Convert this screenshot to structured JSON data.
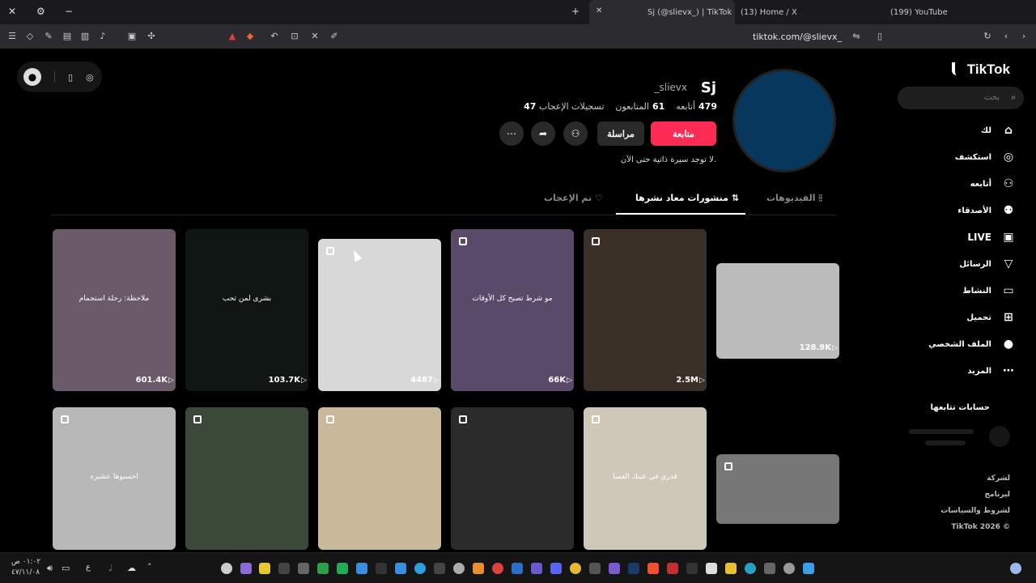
{
  "tabs": [
    {
      "label": "Sj (@slievx_) | TikTok",
      "active": true
    },
    {
      "label": "(13) Home / X",
      "active": false
    },
    {
      "label": "(199) YouTube",
      "active": false
    }
  ],
  "url": "tiktok.com/@slievx_",
  "sidebar": {
    "logo": "TikTok",
    "search_placeholder": "بحث",
    "items": [
      {
        "label": "لك",
        "icon": "home-icon"
      },
      {
        "label": "استكشف",
        "icon": "compass-icon"
      },
      {
        "label": "أتابعه",
        "icon": "user-follow-icon"
      },
      {
        "label": "الأصدقاء",
        "icon": "friends-icon"
      },
      {
        "label": "LIVE",
        "icon": "live-icon"
      },
      {
        "label": "الرسائل",
        "icon": "send-icon"
      },
      {
        "label": "النشاط",
        "icon": "activity-icon"
      },
      {
        "label": "تحميل",
        "icon": "upload-icon"
      },
      {
        "label": "الملف الشخصي",
        "icon": "profile-icon"
      },
      {
        "label": "المزيد",
        "icon": "more-icon"
      }
    ],
    "following_title": "حسابات تتابعها",
    "footer": [
      "لشركة",
      "ليرنامج",
      "لشروط والسياسات",
      "TikTok 2026 ©"
    ]
  },
  "profile": {
    "name": "Sj",
    "handle": "_slievx",
    "following_label": "أتابعه",
    "following_count": "479",
    "followers_label": "المتابعون",
    "followers_count": "61",
    "likes_label": "تسجيلات الإعجاب",
    "likes_count": "47",
    "follow_button": "متابعة",
    "message_button": "مراسلة",
    "bio": "لا توجد سيرة ذاتية حتى الآن."
  },
  "profile_tabs": [
    {
      "label": "الفيديوهات",
      "active": false
    },
    {
      "label": "منشورات معاد نشرها",
      "active": true
    },
    {
      "label": "تم الإعجاب",
      "active": false
    }
  ],
  "videos": [
    {
      "views": "128.9K",
      "bg": "#bbbbbb",
      "text": ""
    },
    {
      "views": "2.5M",
      "bg": "#3a3028",
      "text": ""
    },
    {
      "views": "66K",
      "bg": "#5a4a6a",
      "text": "مو شرط تصبح كل الأوقات"
    },
    {
      "views": "4487",
      "bg": "#d8d8d8",
      "text": ""
    },
    {
      "views": "103.7K",
      "bg": "#101613",
      "text": "بشرى لمن تحب"
    },
    {
      "views": "601.4K",
      "bg": "#6a5a6a",
      "text": "ملاحظة: رحلة استجمام"
    },
    {
      "views": "",
      "bg": "#777777",
      "text": ""
    },
    {
      "views": "",
      "bg": "#cfc8b8",
      "text": "قدري في عينك العميا"
    },
    {
      "views": "",
      "bg": "#2b2b2b",
      "text": ""
    },
    {
      "views": "",
      "bg": "#c9b89a",
      "text": ""
    },
    {
      "views": "",
      "bg": "#3b4a38",
      "text": ""
    },
    {
      "views": "",
      "bg": "#b8b8b8",
      "text": "احسبوها عشيره"
    }
  ],
  "taskbar": {
    "time": "٠١:٠٢ ص",
    "date": "٤٧/١١/٠٨",
    "lang": "ع"
  }
}
